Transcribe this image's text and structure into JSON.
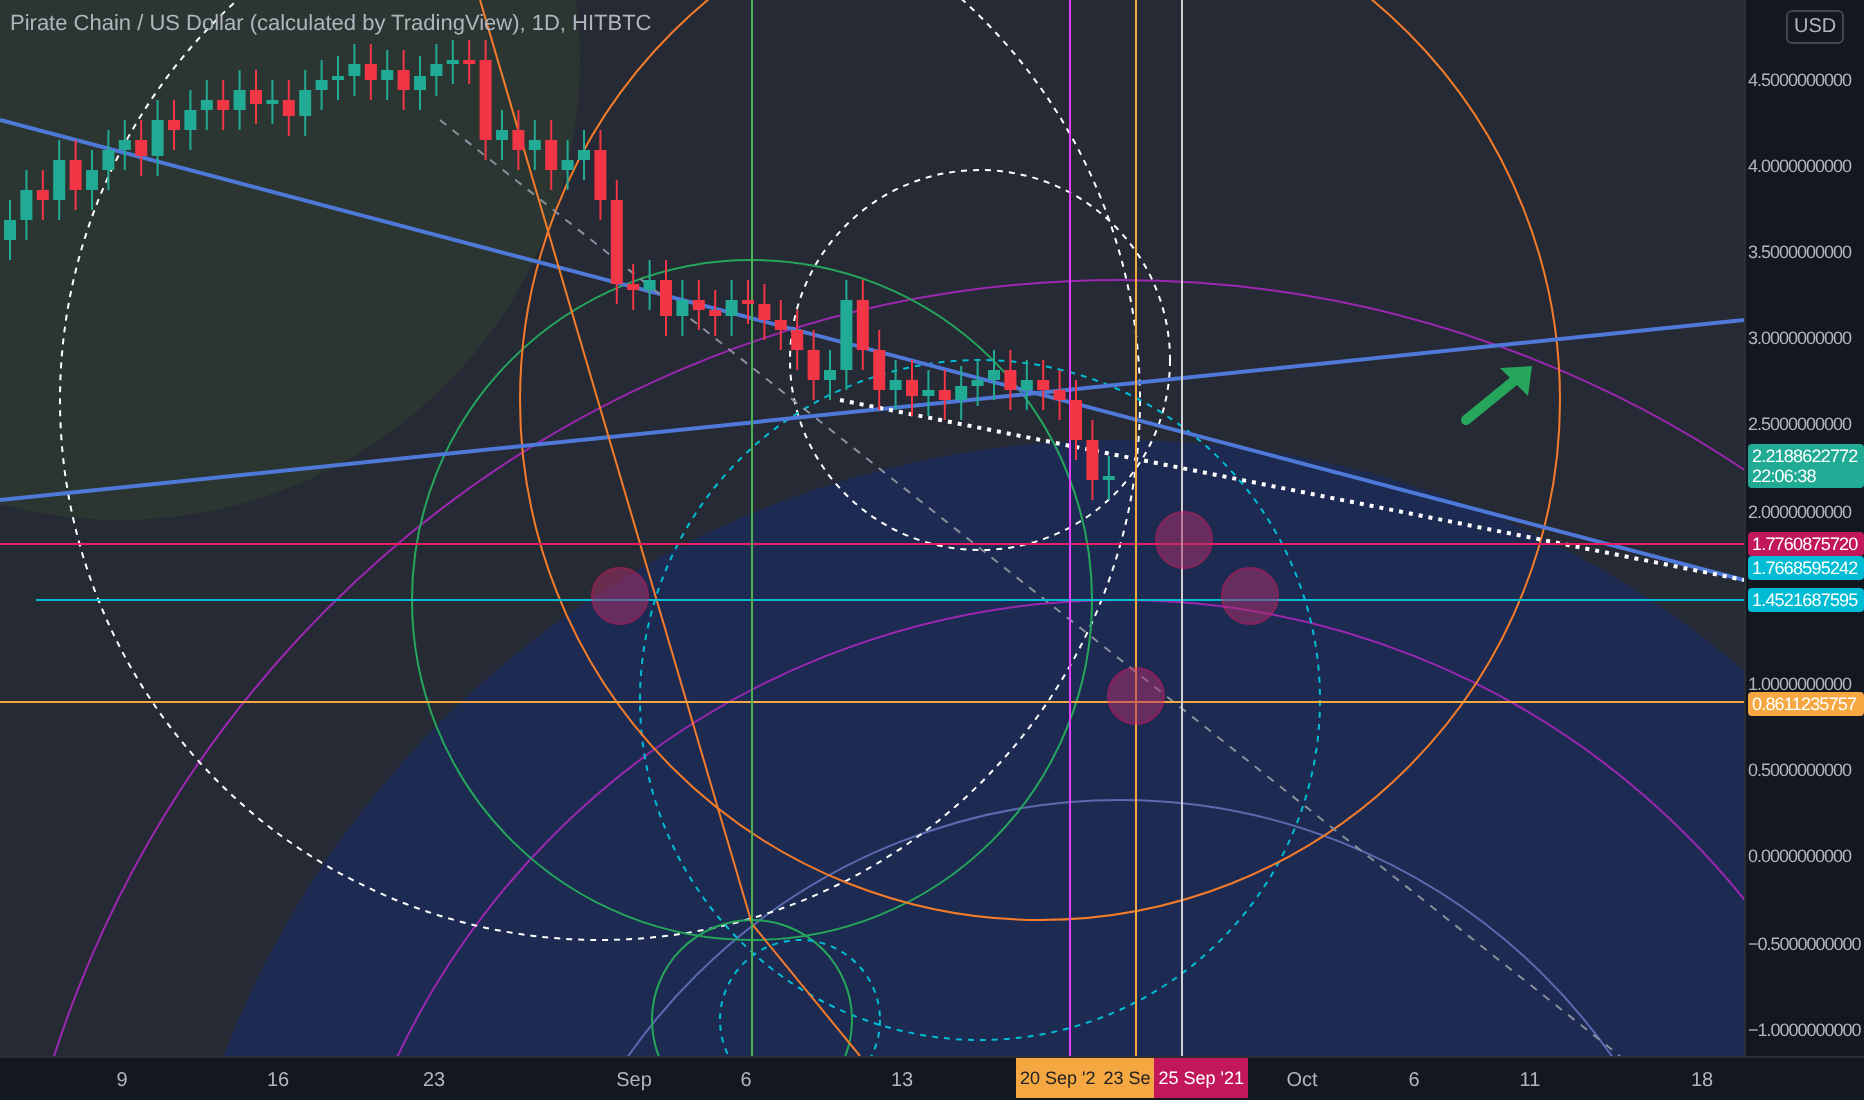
{
  "chart_title": "Pirate Chain / US Dollar (calculated by TradingView), 1D, HITBTC",
  "currency_badge": "USD",
  "price_axis": [
    "4.5000000000",
    "4.0000000000",
    "3.5000000000",
    "3.0000000000",
    "2.5000000000",
    "2.0000000000",
    "1.0000000000",
    "0.5000000000",
    "0.0000000000",
    "−0.5000000000",
    "−1.0000000000"
  ],
  "price_tags": [
    {
      "lines": [
        "2.2188622772",
        "22:06:38"
      ],
      "color": "#22ab94"
    },
    {
      "lines": [
        "1.7760875720"
      ],
      "color": "#c2185b"
    },
    {
      "lines": [
        "1.7668595242"
      ],
      "color": "#00bcd4"
    },
    {
      "lines": [
        "1.4521687595"
      ],
      "color": "#00bcd4"
    },
    {
      "lines": [
        "0.8611235757"
      ],
      "color": "#f5a742"
    }
  ],
  "time_axis": [
    "9",
    "16",
    "23",
    "Sep",
    "6",
    "13",
    "Oct",
    "6",
    "11",
    "18"
  ],
  "time_tags": [
    {
      "label": "20 Sep '2",
      "color": "#f5a742"
    },
    {
      "label": "23 Se",
      "color": "#f5a742"
    },
    {
      "label": "25 Sep '21",
      "color": "#c2185b"
    }
  ]
}
